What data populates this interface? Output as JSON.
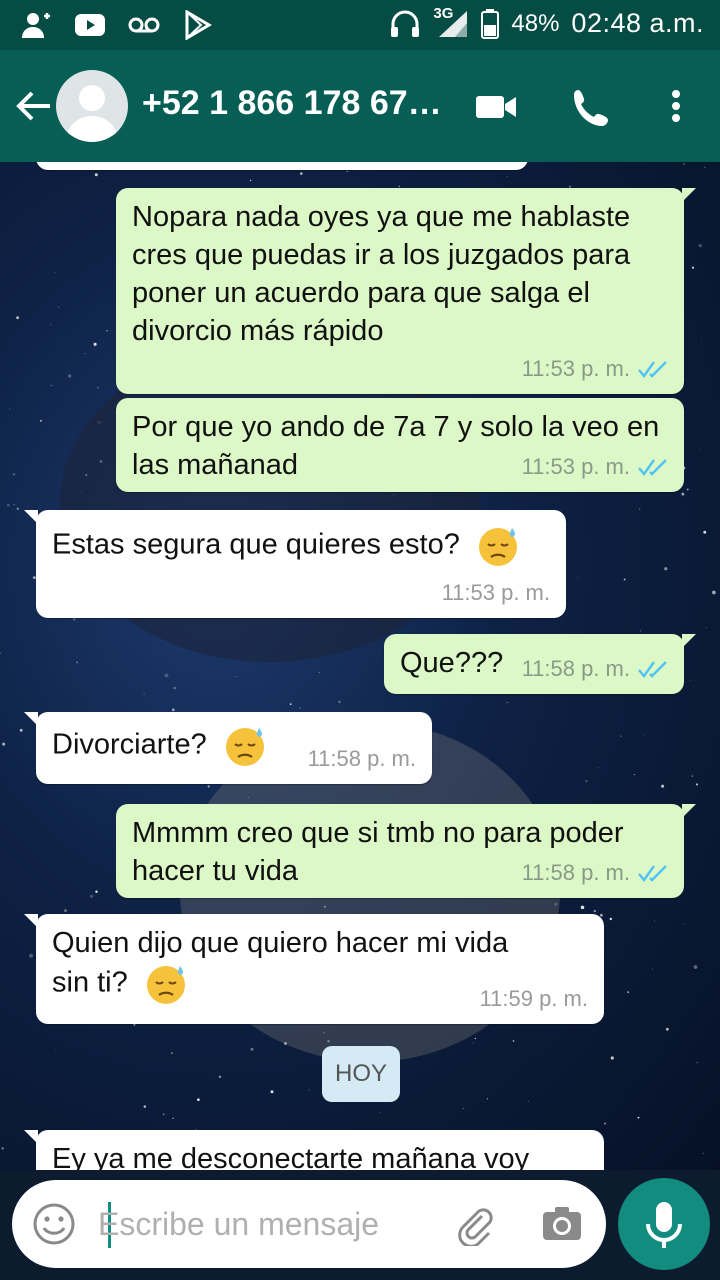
{
  "status_bar": {
    "network": "3G",
    "battery": "48%",
    "time": "02:48 a.m.",
    "left_icons": [
      "add-contact-icon",
      "youtube-icon",
      "voicemail-icon",
      "play-store-icon"
    ],
    "right_icons": [
      "headphones-icon",
      "signal-icon",
      "battery-icon"
    ]
  },
  "header": {
    "contact_name": "+52 1 866 178 67…",
    "icons": [
      "back-arrow-icon",
      "avatar-placeholder-icon",
      "video-call-icon",
      "phone-icon",
      "more-vert-icon"
    ]
  },
  "messages": [
    {
      "direction": "out",
      "text": "Nopara nada oyes ya que me hablaste cres que puedas ir a los juzgados para poner un  acuerdo para que salga el divorcio más rápido",
      "time": "11:53 p. m.",
      "read": true
    },
    {
      "direction": "out",
      "text": "Por que yo ando de 7a 7 y solo la veo en las mañanad",
      "time": "11:53 p. m.",
      "read": true
    },
    {
      "direction": "in",
      "text": "Estas segura que quieres esto?",
      "emoji": "sad-sweat-emoji",
      "time": "11:53 p. m."
    },
    {
      "direction": "out",
      "text": "Que???",
      "time": "11:58 p. m.",
      "read": true
    },
    {
      "direction": "in",
      "text": "Divorciarte?",
      "emoji": "sad-sweat-emoji",
      "time": "11:58 p. m."
    },
    {
      "direction": "out",
      "text": "Mmmm creo que si tmb no para poder hacer tu vida",
      "time": "11:58 p. m.",
      "read": true
    },
    {
      "direction": "in",
      "text": "Quien dijo que quiero hacer mi vida sin ti?",
      "emoji": "sad-sweat-emoji",
      "time": "11:59 p. m."
    },
    {
      "direction": "in",
      "text": "Ey ya me desconectarte mañana voy",
      "time": ""
    }
  ],
  "day_divider": "HOY",
  "composer": {
    "placeholder": "Escribe un mensaje",
    "value": ""
  },
  "colors": {
    "header": "#075e54",
    "status_bar": "#054d44",
    "outgoing_bubble": "#dcf8c6",
    "incoming_bubble": "#ffffff",
    "read_ticks": "#4fc3f7",
    "mic_button": "#128c7e"
  }
}
